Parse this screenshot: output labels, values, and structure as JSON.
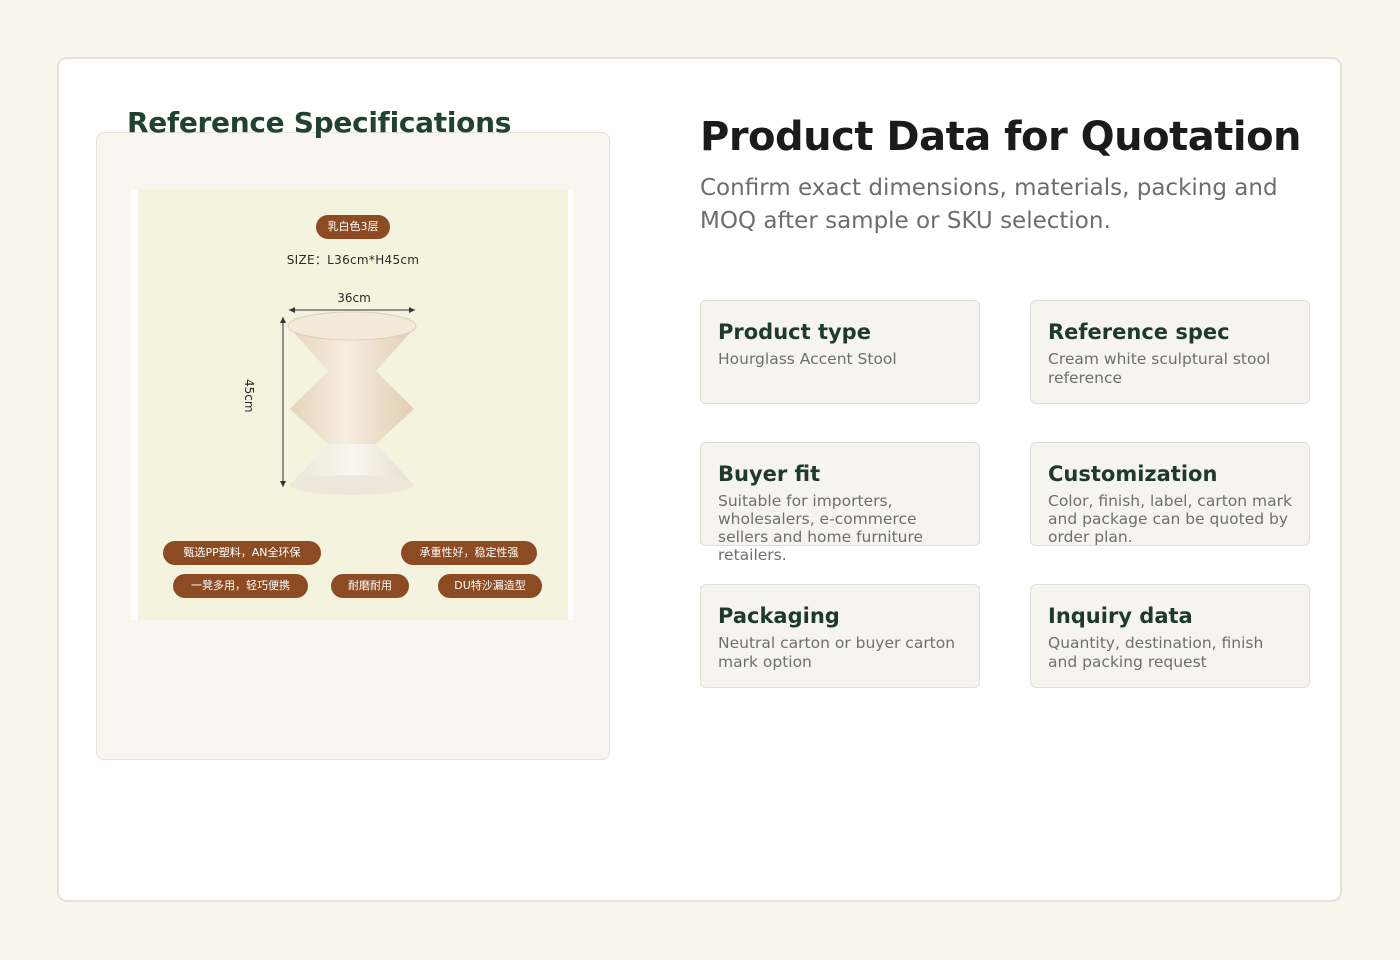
{
  "reference": {
    "heading": "Reference Specifications",
    "image": {
      "color_tag": "乳白色3层",
      "size_text": "SIZE：L36cm*H45cm",
      "width_label": "36cm",
      "height_label": "45cm",
      "feature_tags": [
        "甄选PP塑料，AN全环保",
        "承重性好，稳定性强",
        "一凳多用，轻巧便携",
        "耐磨耐用",
        "DU特沙漏造型"
      ],
      "colors": {
        "tag_bg": "#8c4b22",
        "photo_bg": "#f3f3de",
        "stool": "#efe2cf"
      }
    }
  },
  "main": {
    "title": "Product Data for Quotation",
    "subtitle": "Confirm exact dimensions, materials, packing and MOQ after sample or SKU selection."
  },
  "cards": [
    {
      "title": "Product type",
      "text": "Hourglass Accent Stool"
    },
    {
      "title": "Reference spec",
      "text": "Cream white sculptural stool reference"
    },
    {
      "title": "Buyer fit",
      "text": "Suitable for importers, wholesalers, e-commerce sellers and home furniture retailers."
    },
    {
      "title": "Customization",
      "text": "Color, finish, label, carton mark and package can be quoted by order plan."
    },
    {
      "title": "Packaging",
      "text": "Neutral carton or buyer carton mark option"
    },
    {
      "title": "Inquiry data",
      "text": "Quantity, destination, finish and packing request"
    }
  ],
  "colors": {
    "page_bg": "#f8f6ec",
    "heading_green": "#1f4330",
    "card_bg": "#f5f4ee"
  }
}
